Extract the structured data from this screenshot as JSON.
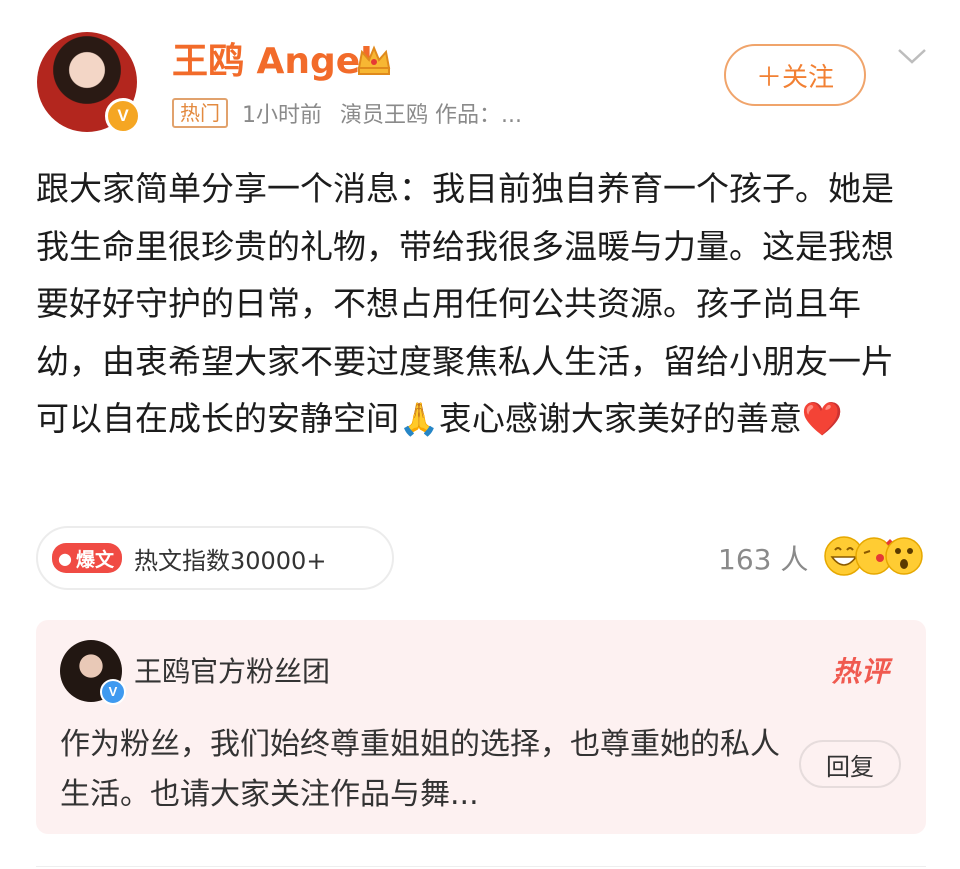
{
  "post": {
    "author": {
      "name": "王鸥 Angel",
      "verified_icon": "orange-v-badge",
      "crown_icon": "gold-crown-icon"
    },
    "meta": {
      "tag": "热门",
      "time": "1小时前",
      "source": "演员王鸥 作品：..."
    },
    "follow_label": "＋关注",
    "body_text": "跟大家简单分享一个消息：我目前独自养育一个孩子。她是我生命里很珍贵的礼物，带给我很多温暖与力量。这是我想要好好守护的日常，不想占用任何公共资源。孩子尚且年幼，由衷希望大家不要过度聚焦私人生活，留给小朋友一片可以自在成长的安静空间",
    "body_emoji_1": "🙏",
    "body_tail": "衷心感谢大家美好的善意",
    "body_emoji_2": "❤️",
    "hot_index": {
      "pill_label": "爆文",
      "text": "热文指数30000+"
    },
    "reactions": {
      "count_label": "163 人",
      "icons": [
        "grin-emoji-icon",
        "kiss-emoji-icon",
        "surprised-emoji-icon"
      ]
    }
  },
  "top_comment": {
    "author": "王鸥官方粉丝团",
    "badge": "热评",
    "text": "作为粉丝，我们始终尊重姐姐的选择，也尊重她的私人生活。也请大家关注作品与舞...",
    "reply_label": "回复"
  },
  "colors": {
    "accent_orange": "#f26b2a",
    "hot_red": "#f04b44",
    "comment_bg": "#fdf1f1"
  }
}
